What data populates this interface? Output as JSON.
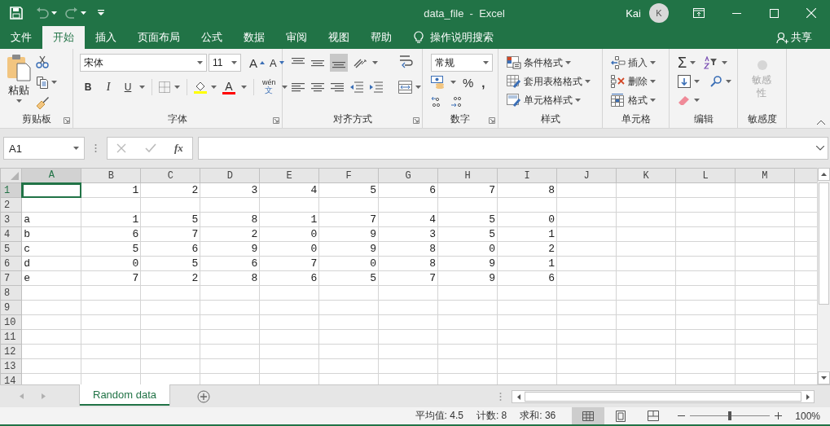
{
  "window": {
    "title": "data_file  -  Excel",
    "user": "Kai",
    "avatar": "K",
    "undo_disabled": true,
    "redo_disabled": true
  },
  "menu_tabs": [
    {
      "label": "文件",
      "selected": false
    },
    {
      "label": "开始",
      "selected": true
    },
    {
      "label": "插入",
      "selected": false
    },
    {
      "label": "页面布局",
      "selected": false
    },
    {
      "label": "公式",
      "selected": false
    },
    {
      "label": "数据",
      "selected": false
    },
    {
      "label": "审阅",
      "selected": false
    },
    {
      "label": "视图",
      "selected": false
    },
    {
      "label": "帮助",
      "selected": false
    }
  ],
  "tell_me": "操作说明搜索",
  "share": "共享",
  "ribbon": {
    "clipboard": {
      "label": "剪贴板",
      "paste": "粘贴"
    },
    "font": {
      "label": "字体",
      "font_name": "宋体",
      "font_size": "11",
      "grow": "A",
      "shrink": "A",
      "bold": "B",
      "italic": "I",
      "underline": "U",
      "font_color": "A",
      "phonetic_top": "wén",
      "phonetic_bottom": "文"
    },
    "alignment": {
      "label": "对齐方式",
      "bottom_align_selected": true
    },
    "number": {
      "label": "数字",
      "format": "常规",
      "percent": "%",
      "comma": ","
    },
    "styles": {
      "label": "样式",
      "items": [
        "条件格式",
        "套用表格格式",
        "单元格样式"
      ]
    },
    "cells": {
      "label": "单元格",
      "items": [
        "插入",
        "删除",
        "格式"
      ]
    },
    "editing": {
      "label": "编辑",
      "sum": "Σ"
    },
    "sensitivity": {
      "label": "敏感度",
      "button": "敏感性",
      "disabled": true
    }
  },
  "formula_bar": {
    "name_box": "A1",
    "function_label": "fx"
  },
  "sheet": {
    "columns": [
      {
        "label": "A",
        "selected": true
      },
      {
        "label": "B",
        "selected": false
      },
      {
        "label": "C",
        "selected": false
      },
      {
        "label": "D",
        "selected": false
      },
      {
        "label": "E",
        "selected": false
      },
      {
        "label": "F",
        "selected": false
      },
      {
        "label": "G",
        "selected": false
      },
      {
        "label": "H",
        "selected": false
      },
      {
        "label": "I",
        "selected": false
      },
      {
        "label": "J",
        "selected": false
      },
      {
        "label": "K",
        "selected": false
      },
      {
        "label": "L",
        "selected": false
      },
      {
        "label": "M",
        "selected": false
      }
    ],
    "rows": [
      {
        "label": "1",
        "selected": true,
        "cells": {
          "B": "1",
          "C": "2",
          "D": "3",
          "E": "4",
          "F": "5",
          "G": "6",
          "H": "7",
          "I": "8"
        }
      },
      {
        "label": "2",
        "selected": false,
        "cells": {}
      },
      {
        "label": "3",
        "selected": false,
        "cells": {
          "A": "a",
          "B": "1",
          "C": "5",
          "D": "8",
          "E": "1",
          "F": "7",
          "G": "4",
          "H": "5",
          "I": "0"
        }
      },
      {
        "label": "4",
        "selected": false,
        "cells": {
          "A": "b",
          "B": "6",
          "C": "7",
          "D": "2",
          "E": "0",
          "F": "9",
          "G": "3",
          "H": "5",
          "I": "1"
        }
      },
      {
        "label": "5",
        "selected": false,
        "cells": {
          "A": "c",
          "B": "5",
          "C": "6",
          "D": "9",
          "E": "0",
          "F": "9",
          "G": "8",
          "H": "0",
          "I": "2"
        }
      },
      {
        "label": "6",
        "selected": false,
        "cells": {
          "A": "d",
          "B": "0",
          "C": "5",
          "D": "6",
          "E": "7",
          "F": "0",
          "G": "8",
          "H": "9",
          "I": "1"
        }
      },
      {
        "label": "7",
        "selected": false,
        "cells": {
          "A": "e",
          "B": "7",
          "C": "2",
          "D": "8",
          "E": "6",
          "F": "5",
          "G": "7",
          "H": "9",
          "I": "6"
        }
      },
      {
        "label": "8",
        "selected": false,
        "cells": {}
      },
      {
        "label": "9",
        "selected": false,
        "cells": {}
      },
      {
        "label": "10",
        "selected": false,
        "cells": {}
      },
      {
        "label": "11",
        "selected": false,
        "cells": {}
      },
      {
        "label": "12",
        "selected": false,
        "cells": {}
      },
      {
        "label": "13",
        "selected": false,
        "cells": {}
      },
      {
        "label": "14",
        "selected": false,
        "cells": {}
      }
    ]
  },
  "sheet_tabs": [
    {
      "label": "Random data",
      "selected": true
    }
  ],
  "status_bar": {
    "average": "平均值: 4.5",
    "count": "计数: 8",
    "sum": "求和: 36",
    "views": [
      {
        "kind": "normal",
        "selected": true
      },
      {
        "kind": "page_layout",
        "selected": false
      },
      {
        "kind": "page_break",
        "selected": false
      }
    ],
    "zoom_slider": {
      "level": 0.5
    },
    "zoom": "100%"
  }
}
